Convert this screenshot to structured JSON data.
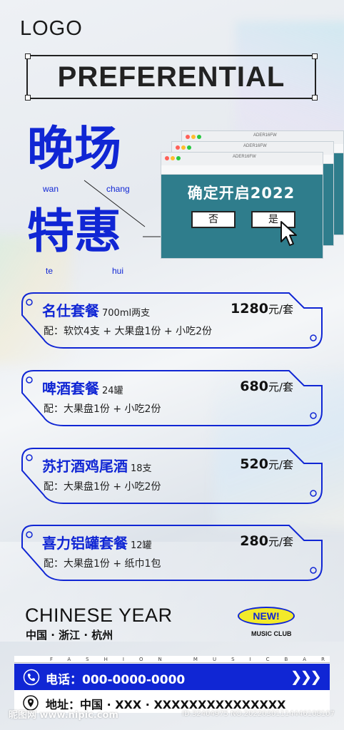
{
  "header": {
    "logo": "LOGO",
    "banner": "PREFERENTIAL"
  },
  "headline": {
    "line1": "晚场",
    "line2": "特惠",
    "pinyin": [
      "wan",
      "chang",
      "te",
      "hui"
    ]
  },
  "dialog": {
    "window_title": "ADER16FW",
    "question": "确定开启2022",
    "no_label": "否",
    "yes_label": "是"
  },
  "packages": [
    {
      "name": "名仕套餐",
      "quantity": "700ml两支",
      "price": "1280",
      "unit": "元/套",
      "includes": "配：软饮4支 + 大果盘1份 + 小吃2份"
    },
    {
      "name": "啤酒套餐",
      "quantity": "24罐",
      "price": "680",
      "unit": "元/套",
      "includes": "配：大果盘1份 + 小吃2份"
    },
    {
      "name": "苏打酒鸡尾酒",
      "quantity": "18支",
      "price": "520",
      "unit": "元/套",
      "includes": "配：大果盘1份 + 小吃2份"
    },
    {
      "name": "喜力铝罐套餐",
      "quantity": "12罐",
      "price": "280",
      "unit": "元/套",
      "includes": "配：大果盘1份 + 纸巾1包"
    }
  ],
  "bottom": {
    "title": "CHINESE YEAR",
    "location": "中国 · 浙江 · 杭州",
    "badge": "NEW!",
    "club": "MUSIC CLUB",
    "strip_text": "FASHION MUSICBAR"
  },
  "contact": {
    "phone": "电话：000-0000-0000",
    "address": "地址：中国 · XXX · XXXXXXXXXXXXXXX"
  },
  "watermark": {
    "left": "昵图网 www.nipic.com",
    "right": "ID:32404975 NO:20220301114446108107"
  },
  "colors": {
    "accent": "#1026d4",
    "dialog": "#2f7d8c",
    "badge": "#f3ea2a"
  }
}
